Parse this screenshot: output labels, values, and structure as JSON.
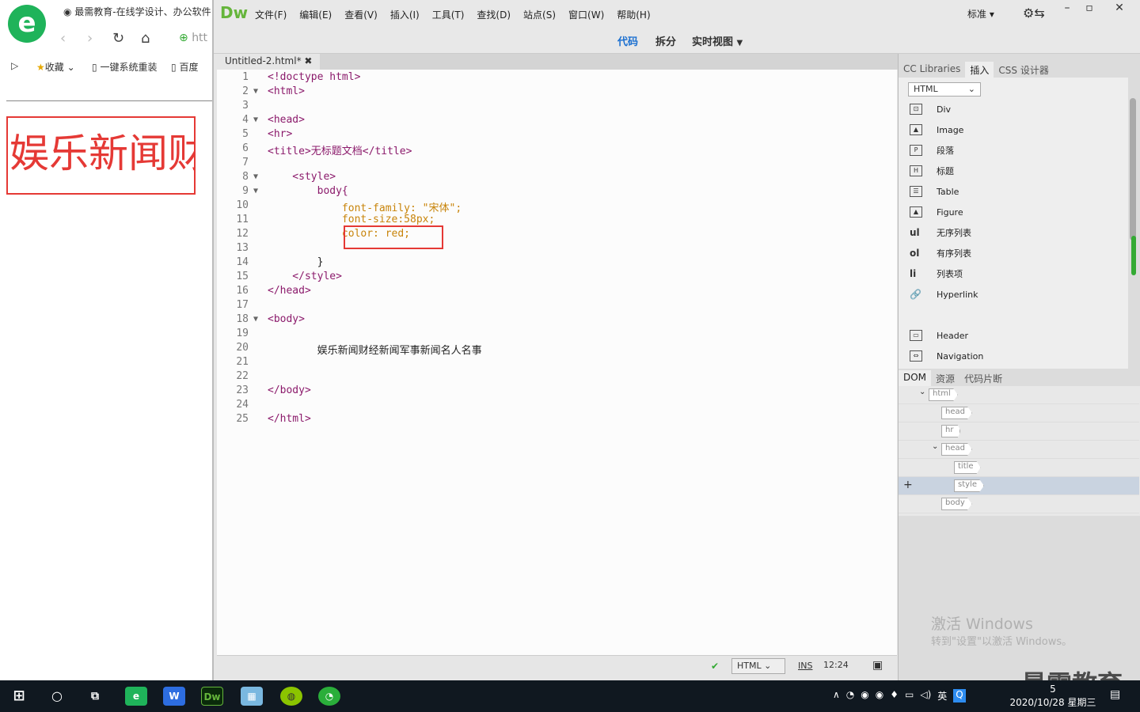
{
  "browser": {
    "tab_title": "最需教育-在线学设计、办公软件",
    "url_text": "htt",
    "bookmarks": [
      "收藏",
      "一键系统重装",
      "百度"
    ],
    "preview_text": "娱乐新闻财经"
  },
  "dw": {
    "logo": "Dw",
    "menus": [
      "文件(F)",
      "编辑(E)",
      "查看(V)",
      "插入(I)",
      "工具(T)",
      "查找(D)",
      "站点(S)",
      "窗口(W)",
      "帮助(H)"
    ],
    "workspace": "标准",
    "views": {
      "code": "代码",
      "split": "拆分",
      "live": "实时视图"
    },
    "doc_tab": "Untitled-2.html*",
    "code_lines": [
      "<!doctype html>",
      "<html>",
      "",
      "<head>",
      "<hr>",
      "<title>无标题文档</title>",
      "",
      "    <style>",
      "        body{",
      "            font-family: \"宋体\";",
      "            font-size:58px;",
      "            color: red;",
      "",
      "        }",
      "    </style>",
      "</head>",
      "",
      "<body>",
      "",
      "        娱乐新闻财经新闻军事新闻名人名事",
      "",
      "",
      "</body>",
      "",
      "</html>"
    ],
    "status": {
      "lang": "HTML",
      "mode": "INS",
      "pos": "12:24"
    }
  },
  "panels": {
    "tabs": [
      "CC Libraries",
      "插入",
      "CSS 设计器"
    ],
    "insert_category": "HTML",
    "insert_items": [
      {
        "icon": "div-icon",
        "label": "Div"
      },
      {
        "icon": "image-icon",
        "label": "Image"
      },
      {
        "icon": "paragraph-icon",
        "label": "段落"
      },
      {
        "icon": "heading-icon",
        "label": "标题"
      },
      {
        "icon": "table-icon",
        "label": "Table"
      },
      {
        "icon": "figure-icon",
        "label": "Figure"
      },
      {
        "icon": "ul",
        "label": "无序列表"
      },
      {
        "icon": "ol",
        "label": "有序列表"
      },
      {
        "icon": "li",
        "label": "列表项"
      },
      {
        "icon": "hyperlink-icon",
        "label": "Hyperlink"
      },
      {
        "icon": "header-icon",
        "label": "Header"
      },
      {
        "icon": "navigation-icon",
        "label": "Navigation"
      }
    ],
    "dom_tabs": [
      "DOM",
      "资源",
      "代码片断"
    ],
    "dom_nodes": [
      "html",
      "head",
      "hr",
      "head",
      "title",
      "style",
      "body"
    ]
  },
  "watermark": {
    "line1": "激活 Windows",
    "line2": "转到\"设置\"以激活 Windows。"
  },
  "brand": "最需教育",
  "taskbar": {
    "ime": "英",
    "time": "5",
    "date": "2020/10/28 星期三"
  }
}
